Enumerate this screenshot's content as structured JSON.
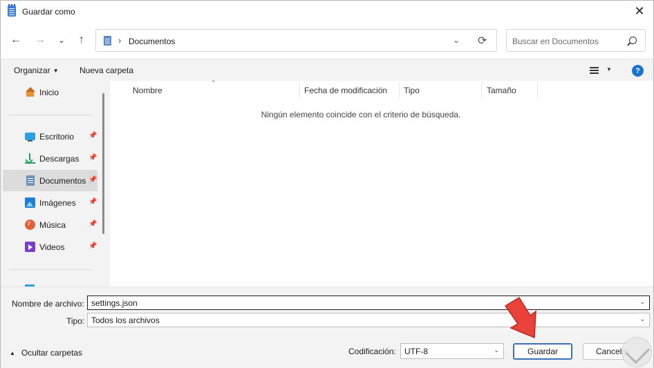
{
  "window": {
    "title": "Guardar como",
    "close_glyph": "✕",
    "icon": "notepad-icon"
  },
  "nav": {
    "back": "←",
    "forward": "→",
    "recent": "⌄",
    "up": "↑",
    "address_sep": "›",
    "address_text": "Documentos",
    "address_dropdown": "⌄",
    "refresh": "⟳",
    "search_placeholder": "Buscar en Documentos"
  },
  "commands": {
    "organize": "Organizar",
    "new_folder": "Nueva carpeta",
    "help": "?"
  },
  "sidebar": {
    "items": [
      {
        "label": "Inicio",
        "icon": "home-icon"
      },
      {
        "label": "Escritorio",
        "icon": "desktop-icon",
        "pinned": true
      },
      {
        "label": "Descargas",
        "icon": "download-icon",
        "pinned": true
      },
      {
        "label": "Documentos",
        "icon": "documents-icon",
        "pinned": true,
        "selected": true
      },
      {
        "label": "Imágenes",
        "icon": "pictures-icon",
        "pinned": true
      },
      {
        "label": "Música",
        "icon": "music-icon",
        "pinned": true
      },
      {
        "label": "Videos",
        "icon": "videos-icon",
        "pinned": true
      }
    ],
    "pin_glyph": "📌"
  },
  "columns": [
    "Nombre",
    "Fecha de modificación",
    "Tipo",
    "Tamaño"
  ],
  "sort_glyph": "⌃",
  "empty_message": "Ningún elemento coincide con el criterio de búsqueda.",
  "form": {
    "filename_label": "Nombre de archivo:",
    "filename_value": "settings.json",
    "type_label": "Tipo:",
    "type_value": "Todos los archivos",
    "dropdown_glyph": "⌄"
  },
  "footer": {
    "hide_folders": "Ocultar carpetas",
    "hide_caret": "▲",
    "encoding_label": "Codificación:",
    "encoding_value": "UTF-8",
    "save": "Guardar",
    "cancel": "Cancelar"
  },
  "colors": {
    "accent": "#1a73d1",
    "arrow": "#e8423a"
  }
}
